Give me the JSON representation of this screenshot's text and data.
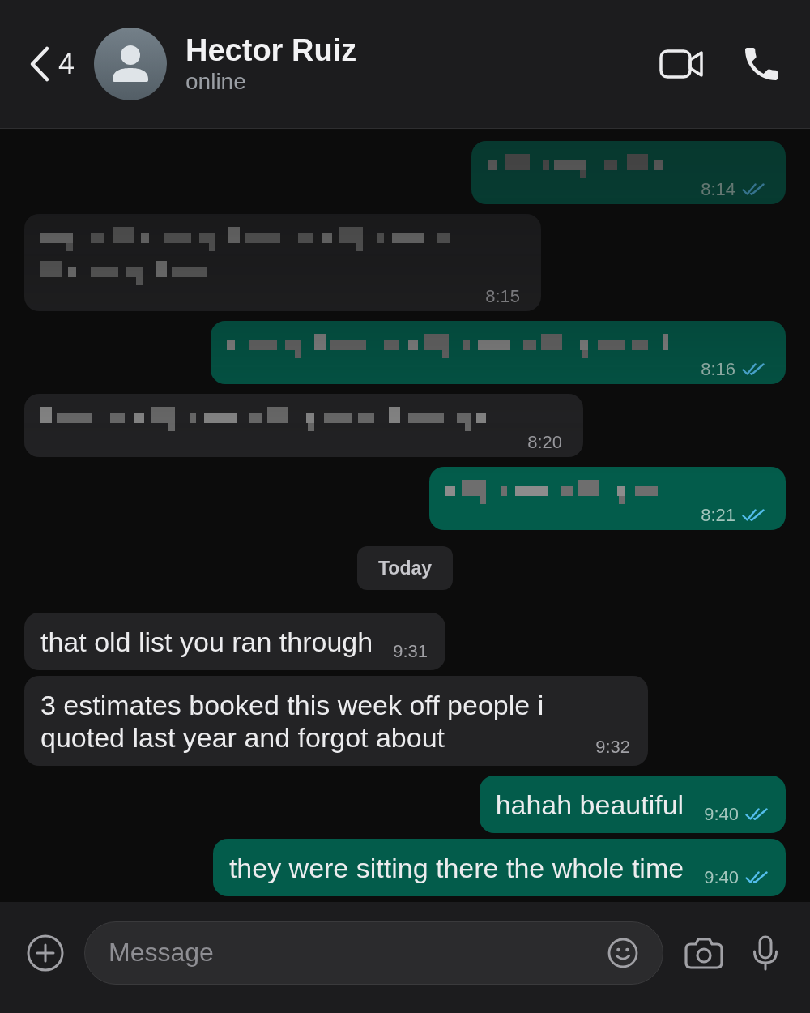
{
  "header": {
    "back_count": "4",
    "contact": {
      "name": "Hector Ruiz",
      "status": "online"
    }
  },
  "messages": [
    {
      "kind": "redacted",
      "outgoing": true,
      "time": "8:14",
      "read": true
    },
    {
      "kind": "redacted",
      "outgoing": false,
      "time": "8:15"
    },
    {
      "kind": "redacted",
      "outgoing": true,
      "time": "8:16",
      "read": true
    },
    {
      "kind": "redacted",
      "outgoing": false,
      "time": "8:20"
    },
    {
      "kind": "redacted",
      "outgoing": true,
      "time": "8:21",
      "read": true
    },
    {
      "kind": "date",
      "label": "Today"
    },
    {
      "kind": "text",
      "outgoing": false,
      "text": "that old list you ran through",
      "time": "9:31"
    },
    {
      "kind": "text",
      "outgoing": false,
      "text": "3 estimates booked this week off people i quoted last year and forgot about",
      "time": "9:32"
    },
    {
      "kind": "text",
      "outgoing": true,
      "text": "hahah beautiful",
      "time": "9:40",
      "read": true
    },
    {
      "kind": "text",
      "outgoing": true,
      "text": "they were sitting there the whole time",
      "time": "9:40",
      "read": true
    }
  ],
  "composer": {
    "placeholder": "Message"
  }
}
